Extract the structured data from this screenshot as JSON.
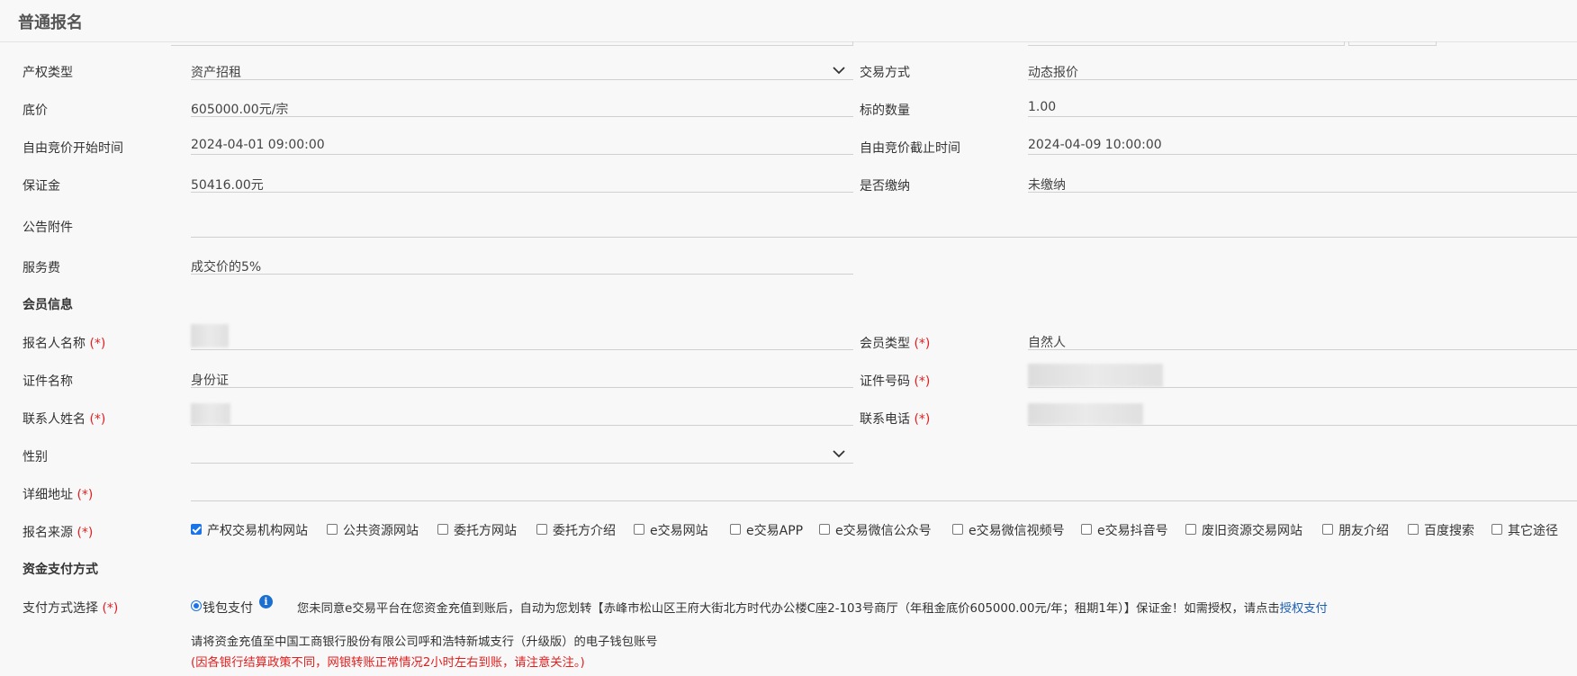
{
  "page": {
    "title": "普通报名"
  },
  "rows": {
    "property_type": {
      "label": "产权类型",
      "value": "资产招租"
    },
    "trade_method": {
      "label": "交易方式",
      "value": "动态报价"
    },
    "base_price": {
      "label": "底价",
      "value": "605000.00元/宗"
    },
    "quantity": {
      "label": "标的数量",
      "value": "1.00"
    },
    "start_time": {
      "label": "自由竞价开始时间",
      "value": "2024-04-01 09:00:00"
    },
    "end_time": {
      "label": "自由竞价截止时间",
      "value": "2024-04-09 10:00:00"
    },
    "deposit": {
      "label": "保证金",
      "value": "50416.00元"
    },
    "paid": {
      "label": "是否缴纳",
      "value": "未缴纳"
    },
    "attachment": {
      "label": "公告附件",
      "value": ""
    },
    "service_fee": {
      "label": "服务费",
      "value": "成交价的5%"
    }
  },
  "member": {
    "section_title": "会员信息",
    "applicant_name": {
      "label": "报名人名称",
      "req": "(*)"
    },
    "member_type": {
      "label": "会员类型",
      "req": "(*)",
      "value": "自然人"
    },
    "id_name": {
      "label": "证件名称",
      "value": "身份证"
    },
    "id_number": {
      "label": "证件号码",
      "req": "(*)"
    },
    "contact_name": {
      "label": "联系人姓名",
      "req": "(*)"
    },
    "contact_phone": {
      "label": "联系电话",
      "req": "(*)"
    },
    "gender": {
      "label": "性别",
      "value": ""
    },
    "address": {
      "label": "详细地址",
      "req": "(*)"
    },
    "source": {
      "label": "报名来源",
      "req": "(*)",
      "options": [
        {
          "label": "产权交易机构网站",
          "checked": true
        },
        {
          "label": "公共资源网站",
          "checked": false
        },
        {
          "label": "委托方网站",
          "checked": false
        },
        {
          "label": "委托方介绍",
          "checked": false
        },
        {
          "label": "e交易网站",
          "checked": false
        },
        {
          "label": "e交易APP",
          "checked": false
        },
        {
          "label": "e交易微信公众号",
          "checked": false
        },
        {
          "label": "e交易微信视频号",
          "checked": false
        },
        {
          "label": "e交易抖音号",
          "checked": false
        },
        {
          "label": "废旧资源交易网站",
          "checked": false
        },
        {
          "label": "朋友介绍",
          "checked": false
        },
        {
          "label": "百度搜索",
          "checked": false
        },
        {
          "label": "其它途径",
          "checked": false
        }
      ]
    }
  },
  "payment": {
    "section_title": "资金支付方式",
    "method": {
      "label": "支付方式选择",
      "req": "(*)",
      "option": "钱包支付"
    },
    "info_icon": "i",
    "notice_text": "您未同意e交易平台在您资金充值到账后，自动为您划转【赤峰市松山区王府大街北方时代办公楼C座2-103号商厅（年租金底价605000.00元/年；租期1年）】保证金！如需授权，请点击",
    "notice_link": "授权支付",
    "bank_line": "请将资金充值至中国工商银行股份有限公司呼和浩特新城支行（升级版）的电子钱包账号",
    "warning": "(因各银行结算政策不同，网银转账正常情况2小时左右到账，请注意关注。)"
  }
}
